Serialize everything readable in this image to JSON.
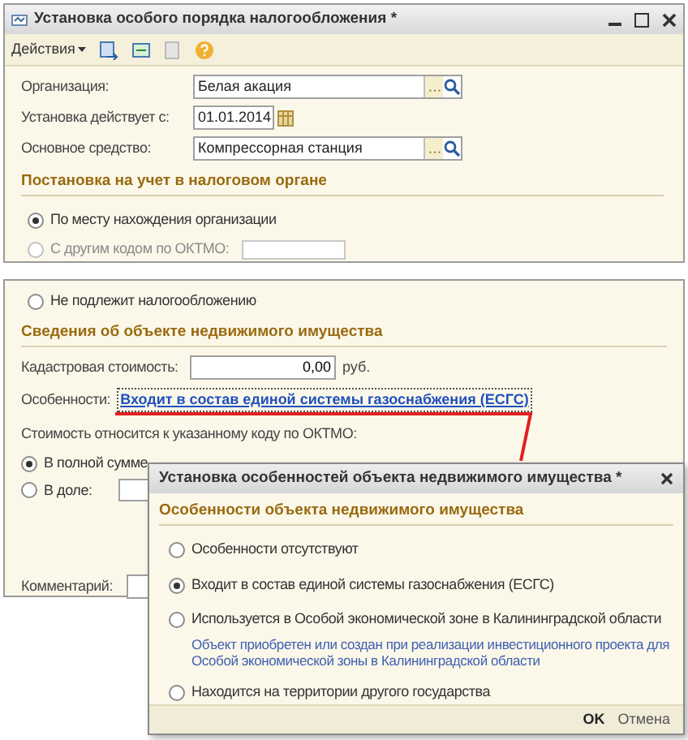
{
  "window": {
    "title": "Установка особого порядка налогообложения *"
  },
  "toolbar": {
    "actions": "Действия"
  },
  "fields": [
    {
      "label": "Организация:",
      "value": "Белая акация",
      "kind": "select"
    },
    {
      "label": "Установка действует с:",
      "value": "01.01.2014",
      "kind": "date"
    },
    {
      "label": "Основное средство:",
      "value": "Компрессорная станция",
      "kind": "select"
    }
  ],
  "registration": {
    "title": "Постановка на учет в налоговом органе",
    "options": [
      {
        "label": "По месту нахождения организации",
        "selected": true
      },
      {
        "label": "С другим кодом по ОКТМО:",
        "selected": false
      },
      {
        "label": "Не подлежит налогообложению",
        "selected": false
      }
    ]
  },
  "property": {
    "title": "Сведения об объекте недвижимого имущества",
    "cadastral_label": "Кадастровая стоимость:",
    "cadastral_value": "0,00",
    "unit": "руб.",
    "features_label": "Особенности:",
    "features_link": "Входит в состав единой системы газоснабжения (ЕСГС)",
    "oktmo_label": "Стоимость относится к указанному коду по ОКТМО:",
    "oktmo_options": [
      {
        "label": "В полной сумме",
        "selected": true
      },
      {
        "label": "В доле:",
        "selected": false
      }
    ],
    "comment_label": "Комментарий:"
  },
  "dialog": {
    "title": "Установка особенностей объекта недвижимого имущества *",
    "section": "Особенности объекта недвижимого имущества",
    "options": [
      {
        "label": "Особенности отсутствуют",
        "selected": false
      },
      {
        "label": "Входит в состав единой системы газоснабжения (ЕСГС)",
        "selected": true
      },
      {
        "label": "Используется в Особой экономической зоне в Калининградской области",
        "selected": false,
        "note": "Объект приобретен или создан при реализации инвестиционного проекта для Особой экономической зоны в Калининградской области"
      },
      {
        "label": "Находится на территории другого государства",
        "selected": false
      }
    ],
    "buttons": [
      {
        "label": "OK",
        "default": true
      },
      {
        "label": "Отмена",
        "default": false
      }
    ]
  }
}
